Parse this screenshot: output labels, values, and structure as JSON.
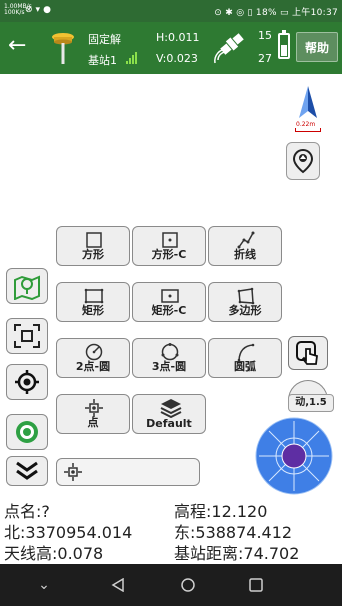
{
  "status_bar": {
    "tiny_text": "1.00MB/s 100K/s",
    "right_text": "⊙ ✱ ◎ ▯ 18% ▭ 上午10:37"
  },
  "header": {
    "back_icon": "back-arrow-icon",
    "solution": "固定解",
    "base": "基站1",
    "h_precision": "H:0.011",
    "v_precision": "V:0.023",
    "sats_used": "15",
    "sats_total": "27",
    "battery_level": 0.5,
    "help_label": "帮助"
  },
  "map": {
    "scale_text": "0.22m"
  },
  "draw_tools": {
    "row1": [
      "方形",
      "方形-C",
      "折线"
    ],
    "row2": [
      "矩形",
      "矩形-C",
      "多边形"
    ],
    "row3": [
      "2点-圆",
      "3点-圆",
      "圆弧"
    ],
    "row4": [
      "点",
      "Default"
    ]
  },
  "speed": {
    "label": "动,1.5"
  },
  "info": {
    "point_name": "点名:?",
    "elevation": "高程:12.120",
    "north": "北:3370954.014",
    "east": "东:538874.412",
    "antenna_height": "天线高:0.078",
    "base_distance": "基站距离:74.702"
  },
  "colors": {
    "header_green": "#2e7a32",
    "accent_blue": "#3f7fe6",
    "joystick_purple": "#5e2ea3"
  }
}
